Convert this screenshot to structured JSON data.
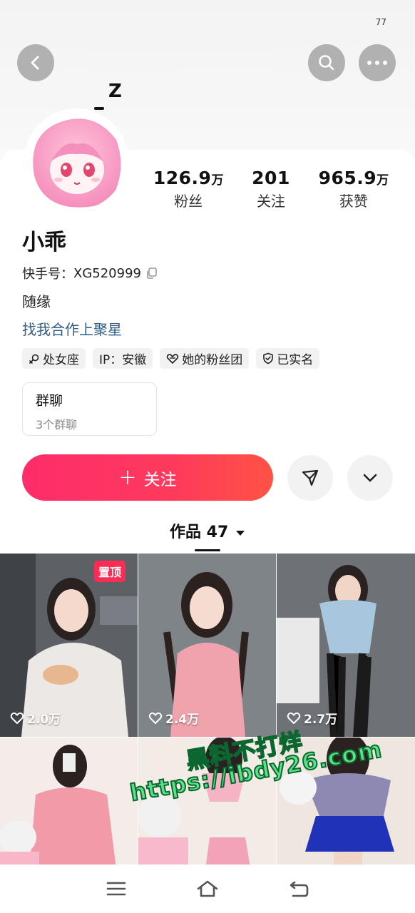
{
  "status_bar": {
    "indicator": "77"
  },
  "header": {
    "back_icon": "chevron-left-icon",
    "search_icon": "search-icon",
    "more_icon": "more-horizontal-icon",
    "sleep_glyph": "Z"
  },
  "profile": {
    "nickname": "小乖",
    "kuaishou_label": "快手号：",
    "kuaishou_id": "XG520999",
    "bio": "随缘",
    "coop_link": "找我合作上聚星",
    "stats": [
      {
        "value": "126.9",
        "unit": "万",
        "label": "粉丝"
      },
      {
        "value": "201",
        "unit": "",
        "label": "关注"
      },
      {
        "value": "965.9",
        "unit": "万",
        "label": "获赞"
      }
    ],
    "tags": [
      {
        "icon": "zodiac-icon",
        "text": "处女座"
      },
      {
        "icon": "",
        "text": "IP：安徽"
      },
      {
        "icon": "heart-outline-icon",
        "text": "她的粉丝团"
      },
      {
        "icon": "shield-check-icon",
        "text": "已实名"
      }
    ],
    "group": {
      "title": "群聊",
      "subtitle": "3个群聊"
    }
  },
  "actions": {
    "follow_label": "关注",
    "follow_plus": "+",
    "share_icon": "send-icon",
    "expand_icon": "chevron-down-icon"
  },
  "works": {
    "label": "作品 47",
    "dropdown_icon": "caret-down-icon",
    "items": [
      {
        "likes": "2.0万",
        "pinned": true,
        "pin_label": "置顶"
      },
      {
        "likes": "2.4万",
        "pinned": false
      },
      {
        "likes": "2.7万",
        "pinned": false
      },
      {
        "likes": "",
        "pinned": false
      },
      {
        "likes": "",
        "pinned": false
      },
      {
        "likes": "",
        "pinned": false
      }
    ]
  },
  "watermark": {
    "line1": "黑料不打烊",
    "line2": "https://ibdy26.com"
  },
  "nav": {
    "menu_icon": "menu-icon",
    "home_icon": "home-icon",
    "back_icon": "back-arrow-icon"
  },
  "colors": {
    "accent": "#fe2c55",
    "link": "#2f5d86",
    "watermark": "#5be287"
  }
}
